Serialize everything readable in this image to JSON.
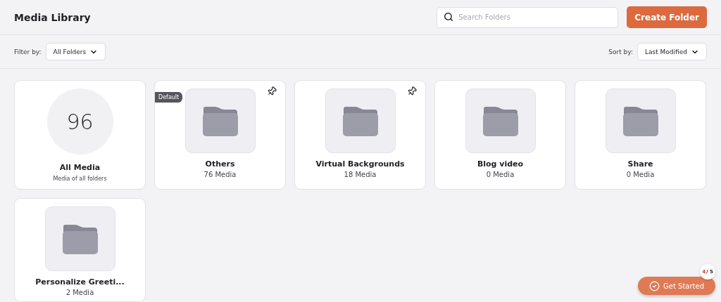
{
  "header": {
    "title": "Media Library",
    "search": {
      "placeholder": "Search Folders"
    },
    "create_button": "Create Folder"
  },
  "filter": {
    "label": "Filter by:",
    "value": "All Folders"
  },
  "sort": {
    "label": "Sort by:",
    "value": "Last Modified"
  },
  "cards": [
    {
      "kind": "all",
      "count": "96",
      "name": "All Media",
      "subtitle": "Media of all folders"
    },
    {
      "kind": "folder",
      "name": "Others",
      "subtitle": "76 Media",
      "pinned": true,
      "badge": "Default"
    },
    {
      "kind": "folder",
      "name": "Virtual Backgrounds",
      "subtitle": "18 Media",
      "pinned": true
    },
    {
      "kind": "folder",
      "name": "Blog video",
      "subtitle": "0 Media",
      "pinned": false
    },
    {
      "kind": "folder",
      "name": "Share",
      "subtitle": "0 Media",
      "pinned": false
    },
    {
      "kind": "folder",
      "name": "Personalize Greeti...",
      "subtitle": "2 Media",
      "pinned": false
    }
  ],
  "get_started": {
    "label": "Get Started",
    "progress_done": "4",
    "progress_rest": "/ 5"
  }
}
